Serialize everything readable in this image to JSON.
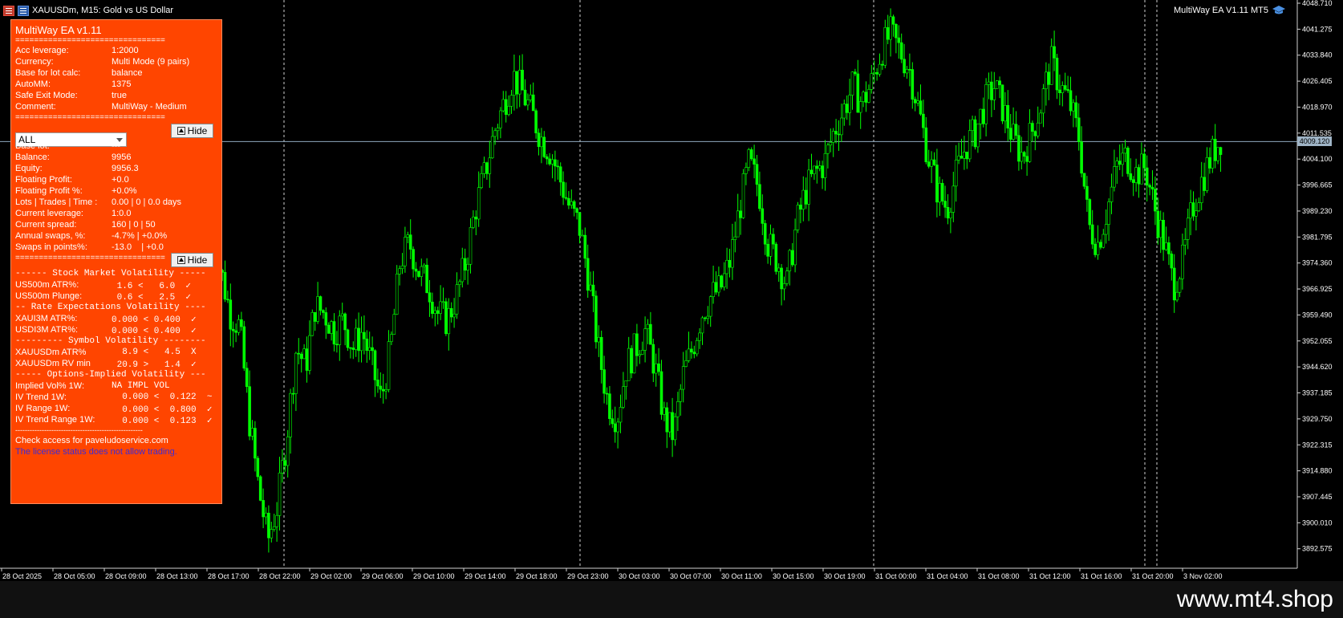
{
  "window": {
    "symbol_title": "XAUUSDm, M15:  Gold vs US Dollar",
    "ea_label": "MultiWay EA V1.11 MT5",
    "current_price_tag": "4009.120",
    "watermark": "www.mt4.shop"
  },
  "chart_data": {
    "type": "candlestick",
    "title": "XAUUSDm, M15:  Gold vs US Dollar",
    "price_axis_labels": [
      "4048.710",
      "4041.275",
      "4033.840",
      "4026.405",
      "4018.970",
      "4011.535",
      "4004.100",
      "3996.665",
      "3989.230",
      "3981.795",
      "3974.360",
      "3966.925",
      "3959.490",
      "3952.055",
      "3944.620",
      "3937.185",
      "3929.750",
      "3922.315",
      "3914.880",
      "3907.445",
      "3900.010",
      "3892.575"
    ],
    "ylim": [
      3887.0,
      4048.71
    ],
    "current_price": 4009.12,
    "time_axis_labels": [
      "28 Oct 2025",
      "28 Oct 05:00",
      "28 Oct 09:00",
      "28 Oct 13:00",
      "28 Oct 17:00",
      "28 Oct 22:00",
      "29 Oct 02:00",
      "29 Oct 06:00",
      "29 Oct 10:00",
      "29 Oct 14:00",
      "29 Oct 18:00",
      "29 Oct 23:00",
      "30 Oct 03:00",
      "30 Oct 07:00",
      "30 Oct 11:00",
      "30 Oct 15:00",
      "30 Oct 19:00",
      "31 Oct 00:00",
      "31 Oct 04:00",
      "31 Oct 08:00",
      "31 Oct 12:00",
      "31 Oct 16:00",
      "31 Oct 20:00",
      "3 Nov 02:00"
    ],
    "closes": [
      3981,
      3972,
      3960,
      3956,
      3930,
      3910,
      3895,
      3905,
      3925,
      3950,
      3945,
      3962,
      3960,
      3955,
      3958,
      3950,
      3955,
      3945,
      3935,
      3950,
      3975,
      3980,
      3972,
      3968,
      3960,
      3958,
      3965,
      3975,
      3990,
      4000,
      4012,
      4020,
      4028,
      4023,
      4017,
      4010,
      4006,
      3998,
      3990,
      3985,
      3970,
      3950,
      3935,
      3930,
      3945,
      3950,
      3955,
      3945,
      3930,
      3925,
      3942,
      3950,
      3960,
      3965,
      3967,
      3975,
      3990,
      4003,
      3996,
      3980,
      3975,
      3968,
      3985,
      3995,
      4000,
      4003,
      4012,
      4018,
      4025,
      4020,
      4026,
      4035,
      4040,
      4035,
      4030,
      4018,
      4005,
      3995,
      3990,
      4000,
      4008,
      4012,
      4020,
      4025,
      4018,
      4010,
      4005,
      4012,
      4020,
      4032,
      4025,
      4020,
      4010,
      3985,
      3980,
      3990,
      4002,
      4005,
      4000,
      4002,
      3990,
      3980,
      3968,
      3975,
      3990,
      3998,
      4005,
      4010
    ]
  },
  "panel": {
    "title": "MultiWay EA v1.11",
    "separator": "================================",
    "dashes": "-----------------------------------------------------",
    "settings": [
      {
        "k": "Acc leverage:",
        "v": "1:2000"
      },
      {
        "k": "Currency:",
        "v": "Multi Mode (9 pairs)"
      },
      {
        "k": "Base for lot calc:",
        "v": "balance"
      },
      {
        "k": "AutoMM:",
        "v": "1375"
      },
      {
        "k": "Safe Exit Mode:",
        "v": "true"
      },
      {
        "k": "Comment:",
        "v": "MultiWay - Medium"
      }
    ],
    "symbol_select": "ALL",
    "hide_label": "Hide",
    "stats": [
      {
        "k": "Base lot:",
        "v": "---"
      },
      {
        "k": "Balance:",
        "v": "9956"
      },
      {
        "k": "Equity:",
        "v": "9956.3"
      },
      {
        "k": "Floating Profit:",
        "v": "+0.0"
      },
      {
        "k": "Floating Profit %:",
        "v": "+0.0%"
      },
      {
        "k": "Lots | Trades | Time :",
        "v": "0.00 | 0 | 0.0 days"
      },
      {
        "k": "Current leverage:",
        "v": "1:0.0"
      },
      {
        "k": "Current spread:",
        "v": "160 | 0 | 50"
      },
      {
        "k": "Annual swaps, %:",
        "v": "-4.7% | +0.0%"
      },
      {
        "k": "Swaps in points%:",
        "v": "-13.0    | +0.0"
      }
    ],
    "sections": [
      {
        "header": "------ Stock Market Volatility -----",
        "rows": [
          {
            "k": "US500m ATR%:",
            "v": " 1.6 <   6.0  ✓"
          },
          {
            "k": "US500m Plunge:",
            "v": " 0.6 <   2.5  ✓"
          }
        ]
      },
      {
        "header": "-- Rate Expectations Volatility ----",
        "rows": [
          {
            "k": "XAUI3M ATR%:",
            "v": "0.000 < 0.400  ✓"
          },
          {
            "k": "USDI3M ATR%:",
            "v": "0.000 < 0.400  ✓"
          }
        ]
      },
      {
        "header": "--------- Symbol Volatility --------",
        "rows": [
          {
            "k": "XAUUSDm ATR%",
            "v": "  8.9 <   4.5  X"
          },
          {
            "k": "XAUUSDm RV min",
            "v": " 20.9 >   1.4  ✓"
          }
        ]
      },
      {
        "header": "----- Options-Implied Volatility ---",
        "rows": [
          {
            "k": "Implied Vol% 1W:",
            "v": "NA IMPL VOL"
          },
          {
            "k": "IV Trend 1W:",
            "v": "  0.000 <  0.122  ~"
          },
          {
            "k": "IV Range 1W:",
            "v": "  0.000 <  0.800  ✓"
          },
          {
            "k": "IV Trend Range 1W:",
            "v": "  0.000 <  0.123  ✓"
          }
        ]
      }
    ],
    "footer_access": "Check access for paveludoservice.com",
    "footer_license": "The license status does not allow trading."
  }
}
